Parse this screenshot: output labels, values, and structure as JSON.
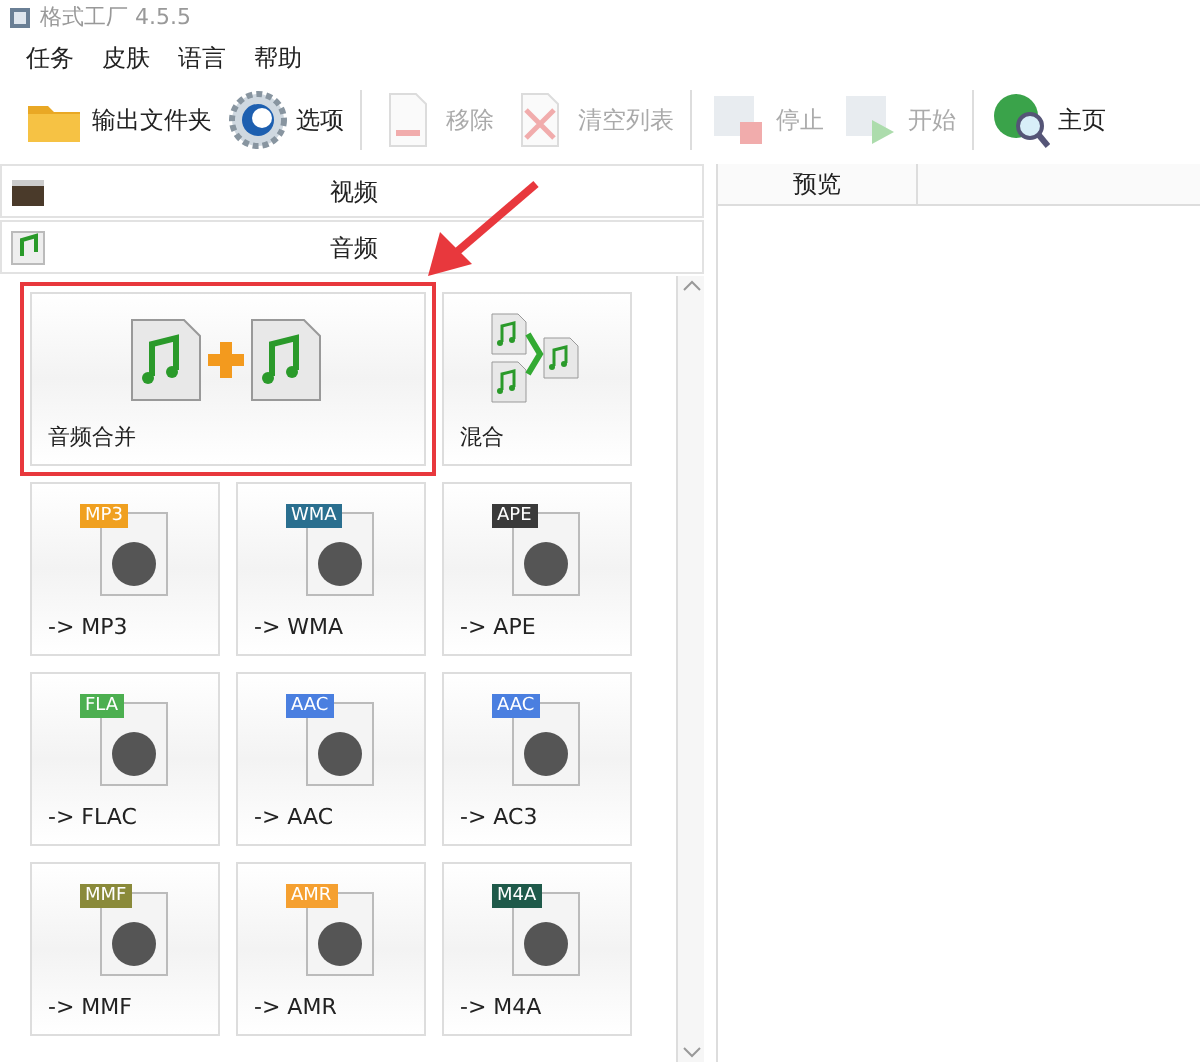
{
  "window": {
    "title": "格式工厂 4.5.5"
  },
  "menu": [
    "任务",
    "皮肤",
    "语言",
    "帮助"
  ],
  "toolbar": [
    {
      "kind": "folder",
      "label": "输出文件夹",
      "disabled": false
    },
    {
      "kind": "options",
      "label": "选项",
      "disabled": false
    },
    {
      "kind": "remove",
      "label": "移除",
      "disabled": true
    },
    {
      "kind": "clear",
      "label": "清空列表",
      "disabled": true
    },
    {
      "kind": "stop",
      "label": "停止",
      "disabled": true
    },
    {
      "kind": "start",
      "label": "开始",
      "disabled": true
    },
    {
      "kind": "home",
      "label": "主页",
      "disabled": false
    }
  ],
  "categories": [
    {
      "kind": "video",
      "label": "视频"
    },
    {
      "kind": "audio",
      "label": "音频"
    }
  ],
  "tiles": [
    {
      "kind": "merge",
      "label": "音频合并",
      "highlighted": true
    },
    {
      "kind": "mix",
      "label": "混合",
      "highlighted": false
    },
    {
      "kind": "format",
      "tag": "MP3",
      "color": "#f0a020",
      "label": "-> MP3",
      "highlighted": false
    },
    {
      "kind": "format",
      "tag": "WMA",
      "color": "#2a6f8f",
      "label": "-> WMA",
      "highlighted": false
    },
    {
      "kind": "format",
      "tag": "APE",
      "color": "#3a3a3a",
      "label": "-> APE",
      "highlighted": false
    },
    {
      "kind": "format",
      "tag": "FLA",
      "color": "#4caf50",
      "label": "-> FLAC",
      "highlighted": false
    },
    {
      "kind": "format",
      "tag": "AAC",
      "color": "#4a7fe0",
      "label": "-> AAC",
      "highlighted": false
    },
    {
      "kind": "format",
      "tag": "AAC",
      "color": "#4a7fe0",
      "label": "-> AC3",
      "highlighted": false
    },
    {
      "kind": "format",
      "tag": "MMF",
      "color": "#8a8a3a",
      "label": "-> MMF",
      "highlighted": false
    },
    {
      "kind": "format",
      "tag": "AMR",
      "color": "#f5a030",
      "label": "-> AMR",
      "highlighted": false
    },
    {
      "kind": "format",
      "tag": "M4A",
      "color": "#1f5a4a",
      "label": "-> M4A",
      "highlighted": false
    }
  ],
  "preview": {
    "columns": [
      "预览"
    ]
  }
}
